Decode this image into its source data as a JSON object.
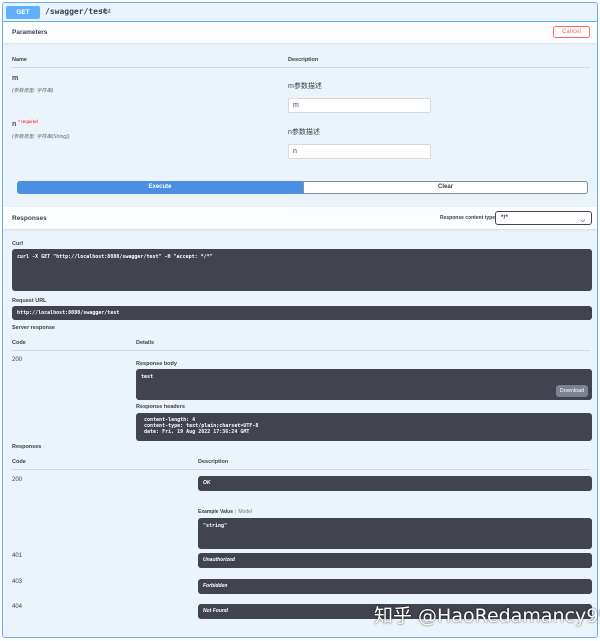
{
  "operation": {
    "method": "GET",
    "path": "/swagger/test",
    "summary": "test"
  },
  "parameters": {
    "title": "Parameters",
    "cancel_label": "Cancel",
    "col_name": "Name",
    "col_description": "Description",
    "items": [
      {
        "name": "m",
        "required": "",
        "type": "(参数类型: 字符串)",
        "description": "m参数描述",
        "value": "m"
      },
      {
        "name": "n",
        "required": "* required",
        "type": "(参数类型: 字符串(String))",
        "description": "n参数描述",
        "value": "n"
      }
    ],
    "execute_label": "Execute",
    "clear_label": "Clear"
  },
  "responses_header": {
    "title": "Responses",
    "content_type_label": "Response content type",
    "content_type_value": "*/*"
  },
  "live": {
    "curl_label": "Curl",
    "curl_value": "curl -X GET \"http://localhost:8080/swagger/test\" -H \"accept: */*\"",
    "request_url_label": "Request URL",
    "request_url_value": "http://localhost:8080/swagger/test",
    "server_response_label": "Server response",
    "col_code": "Code",
    "col_details": "Details",
    "code": "200",
    "response_body_label": "Response body",
    "response_body": "test",
    "download_label": "Download",
    "response_headers_label": "Response headers",
    "response_headers": " content-length: 4\n content-type: text/plain;charset=UTF-8\n date: Fri, 19 Aug 2022 17:36:24 GMT"
  },
  "documented": {
    "title": "Responses",
    "col_code": "Code",
    "col_description": "Description",
    "items": [
      {
        "code": "200",
        "description": "OK"
      },
      {
        "code": "401",
        "description": "Unauthorized"
      },
      {
        "code": "403",
        "description": "Forbidden"
      },
      {
        "code": "404",
        "description": "Not Found"
      }
    ],
    "example_value_label": "Example Value",
    "model_label": "Model",
    "example_value": "\"string\""
  },
  "watermark": "知乎 @HaoRedamancy99",
  "colors": {
    "get_blue": "#61affe",
    "execute_blue": "#4990e2",
    "dark_box": "#41444e",
    "cancel_red": "#ff6060",
    "block_bg": "#ebf3fb"
  }
}
